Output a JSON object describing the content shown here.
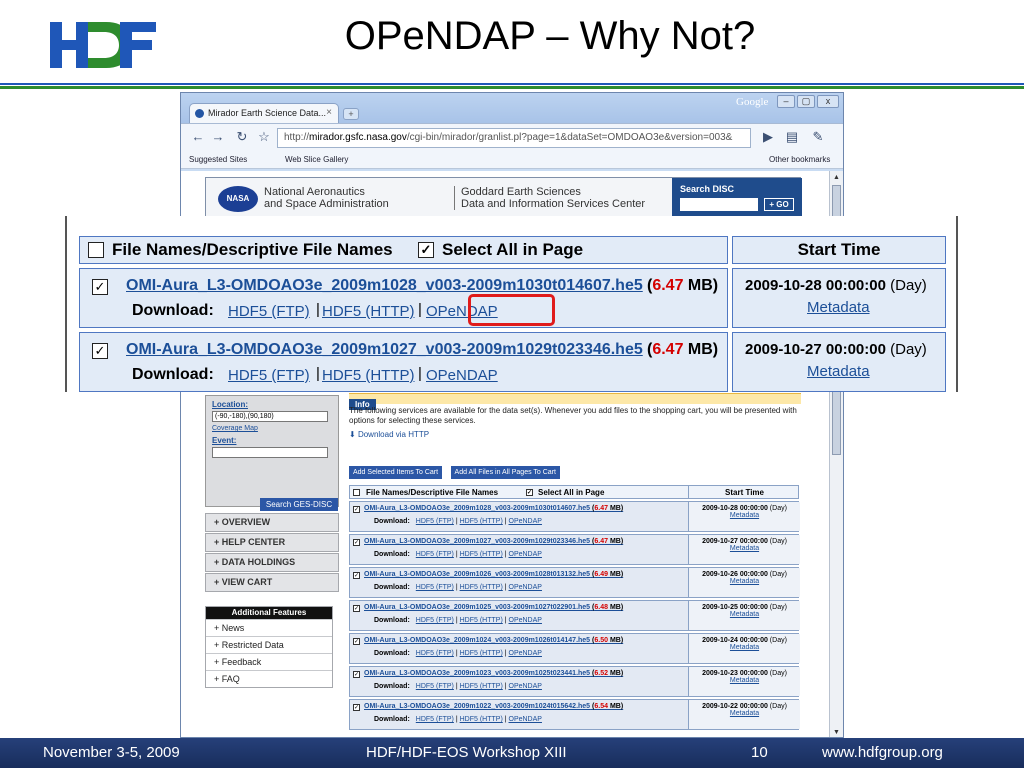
{
  "slide": {
    "title": "OPeNDAP – Why Not?",
    "footer": {
      "date": "November 3-5, 2009",
      "event": "HDF/HDF-EOS Workshop XIII",
      "page": "10",
      "url": "www.hdfgroup.org"
    },
    "colors": {
      "logo_blue": "#1f57b8",
      "logo_green": "#2e8c2e",
      "footer": "#1f3a72"
    }
  },
  "browser": {
    "tab_title": "Mirador Earth Science Data...",
    "tab_close": "×",
    "new_tab": "+",
    "brand": "Google",
    "url_prefix": "http://",
    "url_host": "mirador.gsfc.nasa.gov",
    "url_rest": "/cgi-bin/mirador/granlist.pl?page=1&dataSet=OMDOAO3e&version=003&",
    "bookmark_1": "Suggested Sites",
    "bookmark_2": "Web Slice Gallery",
    "bookmark_3": "Other bookmarks"
  },
  "site": {
    "nasa_logo": "NASA",
    "agency_line1": "National Aeronautics",
    "agency_line2": "and Space Administration",
    "center_line1": "Goddard Earth Sciences",
    "center_line2": "Data and Information Services Center",
    "search_title": "Search DISC",
    "search_go": "+ GO"
  },
  "sidebar": {
    "location_label": "Location:",
    "location_value": "(-90,-180),(90,180)",
    "coverage_map": "Coverage Map",
    "event_label": "Event:",
    "search_button": "Search GES-DISC",
    "nav": [
      "+ OVERVIEW",
      "+ HELP CENTER",
      "+ DATA HOLDINGS",
      "+ VIEW CART"
    ],
    "features_title": "Additional Features",
    "features": [
      "+ News",
      "+ Restricted Data",
      "+ Feedback",
      "+ FAQ"
    ]
  },
  "main": {
    "info_tag": "Info",
    "info_text": "The following services are available for the data set(s). Whenever you add files to the shopping cart, you will be presented with options for selecting these services.",
    "download_http": "Download via HTTP",
    "add_selected": "Add Selected Items To Cart",
    "add_all": "Add All Files in All Pages To Cart"
  },
  "table": {
    "col_files": "File Names/Descriptive File Names",
    "col_select_all": "Select All in Page",
    "col_time": "Start Time",
    "download_label": "Download:",
    "link_ftp": "HDF5 (FTP)",
    "link_http": "HDF5 (HTTP)",
    "link_opendap": "OPeNDAP",
    "metadata": "Metadata",
    "size_open": "(",
    "size_close": " MB)",
    "day_label": " (Day)",
    "check_mark": "✓",
    "rows": [
      {
        "file": "OMI-Aura_L3-OMDOAO3e_2009m1028_v003-2009m1030t014607.he5",
        "size": "6.47",
        "time": "2009-10-28 00:00:00"
      },
      {
        "file": "OMI-Aura_L3-OMDOAO3e_2009m1027_v003-2009m1029t023346.he5",
        "size": "6.47",
        "time": "2009-10-27 00:00:00"
      },
      {
        "file": "OMI-Aura_L3-OMDOAO3e_2009m1026_v003-2009m1028t013132.he5",
        "size": "6.49",
        "time": "2009-10-26 00:00:00"
      },
      {
        "file": "OMI-Aura_L3-OMDOAO3e_2009m1025_v003-2009m1027t022901.he5",
        "size": "6.48",
        "time": "2009-10-25 00:00:00"
      },
      {
        "file": "OMI-Aura_L3-OMDOAO3e_2009m1024_v003-2009m1026t014147.he5",
        "size": "6.50",
        "time": "2009-10-24 00:00:00"
      },
      {
        "file": "OMI-Aura_L3-OMDOAO3e_2009m1023_v003-2009m1025t023441.he5",
        "size": "6.52",
        "time": "2009-10-23 00:00:00"
      },
      {
        "file": "OMI-Aura_L3-OMDOAO3e_2009m1022_v003-2009m1024t015642.he5",
        "size": "6.54",
        "time": "2009-10-22 00:00:00"
      }
    ]
  }
}
